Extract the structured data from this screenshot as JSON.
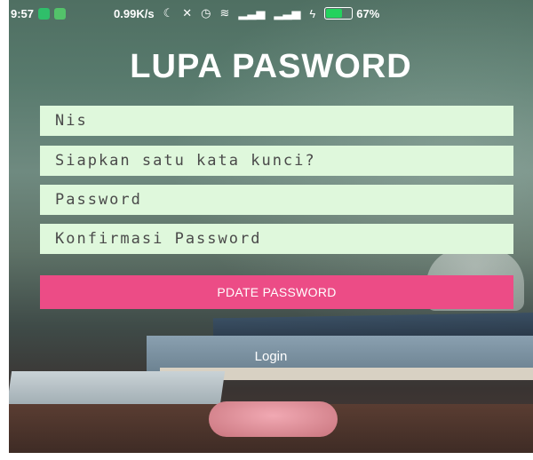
{
  "status_bar": {
    "time": "9:57",
    "network_speed": "0.99K/s",
    "battery_percent": "67%",
    "battery_level": 0.67,
    "icons": [
      "whatsapp-icon",
      "android-icon",
      "moon-icon",
      "mute-icon",
      "alarm-icon",
      "wifi-icon",
      "signal-icon",
      "signal-icon",
      "charging-icon",
      "battery-icon"
    ]
  },
  "title": "LUPA PASWORD",
  "form": {
    "nis_placeholder": "Nis",
    "question_placeholder": "Siapkan satu kata kunci?",
    "password_placeholder": "Password",
    "confirm_placeholder": "Konfirmasi Password",
    "update_label": "PDATE PASSWORD",
    "login_label": "Login"
  },
  "colors": {
    "field_bg": "#dff8dc",
    "button_bg": "#ec4c86",
    "battery_fill": "#23d25d"
  }
}
